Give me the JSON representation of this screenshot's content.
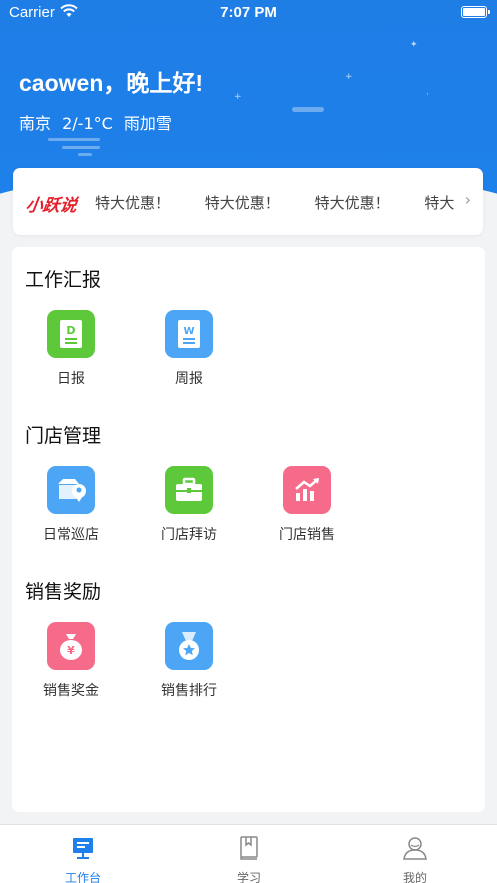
{
  "status_bar": {
    "carrier": "Carrier",
    "time": "7:07 PM"
  },
  "header": {
    "greeting": "caowen，晚上好!",
    "weather": {
      "city": "南京",
      "temperature": "2/-1°C",
      "condition": "雨加雪"
    }
  },
  "notice": {
    "logo": "小跃说",
    "items": [
      "特大优惠！",
      "特大优惠！",
      "特大优惠！",
      "特大..."
    ]
  },
  "sections": [
    {
      "title": "工作汇报",
      "apps": [
        {
          "label": "日报",
          "icon": "daily-report-icon",
          "color": "#5cc83a"
        },
        {
          "label": "周报",
          "icon": "weekly-report-icon",
          "color": "#4da6f5"
        }
      ]
    },
    {
      "title": "门店管理",
      "apps": [
        {
          "label": "日常巡店",
          "icon": "store-patrol-icon",
          "color": "#4da6f5"
        },
        {
          "label": "门店拜访",
          "icon": "briefcase-icon",
          "color": "#5cc83a"
        },
        {
          "label": "门店销售",
          "icon": "sales-chart-icon",
          "color": "#f76b8a"
        }
      ]
    },
    {
      "title": "销售奖励",
      "apps": [
        {
          "label": "销售奖金",
          "icon": "money-bag-icon",
          "color": "#f76b8a"
        },
        {
          "label": "销售排行",
          "icon": "medal-icon",
          "color": "#4da6f5"
        }
      ]
    }
  ],
  "tabbar": [
    {
      "label": "工作台",
      "icon": "workbench-icon",
      "active": true
    },
    {
      "label": "学习",
      "icon": "book-icon",
      "active": false
    },
    {
      "label": "我的",
      "icon": "user-icon",
      "active": false
    }
  ],
  "colors": {
    "primary": "#1e80ea",
    "brand_red": "#e4202a"
  }
}
